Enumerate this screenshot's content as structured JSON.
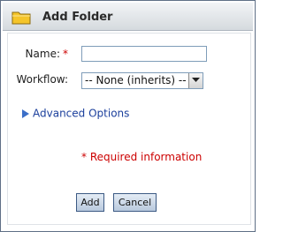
{
  "dialog": {
    "title": "Add Folder",
    "icon": "folder-icon"
  },
  "form": {
    "name_label": "Name:",
    "required_marker": "*",
    "name_value": "",
    "workflow_label": "Workflow:",
    "workflow_selected": "-- None (inherits) --",
    "advanced_options_label": "Advanced Options",
    "required_info": "* Required information"
  },
  "buttons": {
    "add_label": "Add",
    "cancel_label": "Cancel"
  },
  "colors": {
    "required": "#cc0000",
    "link": "#1b3f9c",
    "folder": "#f5c52a"
  }
}
